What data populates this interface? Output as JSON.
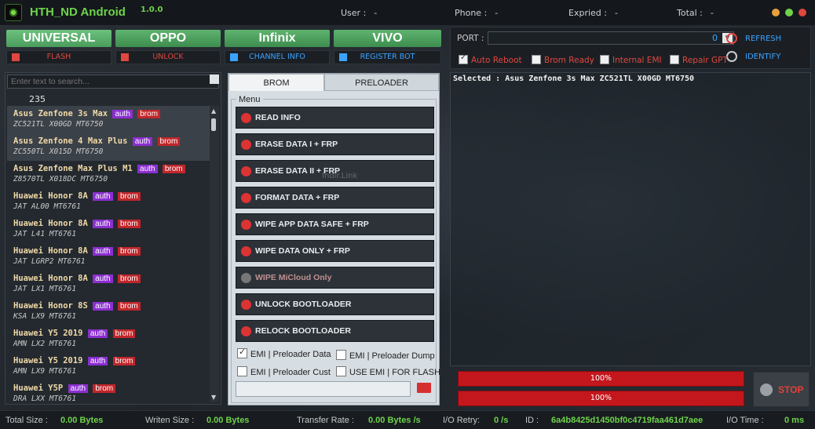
{
  "app": {
    "title": "HTH_ND Android",
    "version": "1.0.0"
  },
  "header": {
    "user_label": "User :",
    "user_value": "-",
    "phone_label": "Phone :",
    "phone_value": "-",
    "expired_label": "Expried :",
    "expired_value": "-",
    "total_label": "Total :",
    "total_value": "-"
  },
  "window_controls": {
    "colors": [
      "#e8a13a",
      "#6fd34a",
      "#e0473f"
    ]
  },
  "brands": [
    "UNIVERSAL",
    "OPPO",
    "Infinix",
    "VIVO"
  ],
  "subbuttons": [
    {
      "label": "FLASH",
      "icon": "flash-icon",
      "color": "#e0473f"
    },
    {
      "label": "UNLOCK",
      "icon": "unlock-icon",
      "color": "#e0473f"
    },
    {
      "label": "CHANNEL INFO",
      "icon": "channel-info-icon",
      "color": "#3ba3ff"
    },
    {
      "label": "REGISTER BOT",
      "icon": "register-bot-icon",
      "color": "#3ba3ff"
    }
  ],
  "model_list": {
    "search_placeholder": "Enter text to search...",
    "count": "235",
    "items": [
      {
        "name": "Asus Zenfone 3s Max",
        "code": "ZC521TL X00GD MT6750",
        "badge1": "auth",
        "badge2": "brom"
      },
      {
        "name": "Asus Zenfone 4 Max Plus",
        "code": "ZC550TL X015D MT6750",
        "badge1": "auth",
        "badge2": "brom"
      },
      {
        "name": "Asus Zenfone Max Plus M1",
        "code": "Z8570TL X018DC MT6750",
        "badge1": "auth",
        "badge2": "brom"
      },
      {
        "name": "Huawei Honor 8A",
        "code": "JAT AL00 MT6761",
        "badge1": "auth",
        "badge2": "brom"
      },
      {
        "name": "Huawei Honor 8A",
        "code": "JAT L41 MT6761",
        "badge1": "auth",
        "badge2": "brom"
      },
      {
        "name": "Huawei Honor 8A",
        "code": "JAT LGRP2 MT6761",
        "badge1": "auth",
        "badge2": "brom"
      },
      {
        "name": "Huawei Honor 8A",
        "code": "JAT LX1 MT6761",
        "badge1": "auth",
        "badge2": "brom"
      },
      {
        "name": "Huawei Honor 8S",
        "code": "KSA LX9 MT6761",
        "badge1": "auth",
        "badge2": "brom"
      },
      {
        "name": "Huawei Y5 2019",
        "code": "AMN LX2 MT6761",
        "badge1": "auth",
        "badge2": "brom"
      },
      {
        "name": "Huawei Y5 2019",
        "code": "AMN LX9 MT6761",
        "badge1": "auth",
        "badge2": "brom"
      },
      {
        "name": "Huawei Y5P",
        "code": "DRA LXX MT6761",
        "badge1": "auth",
        "badge2": "brom"
      }
    ]
  },
  "center": {
    "tabs": [
      "BROM",
      "PRELOADER"
    ],
    "menu_label": "Menu",
    "actions": [
      {
        "label": "READ INFO",
        "icon": "read-info-icon"
      },
      {
        "label": "ERASE DATA I + FRP",
        "icon": "erase-icon"
      },
      {
        "label": "ERASE DATA II + FRP",
        "icon": "erase-icon"
      },
      {
        "label": "FORMAT DATA + FRP",
        "icon": "format-icon"
      },
      {
        "label": "WIPE APP DATA SAFE + FRP",
        "icon": "wipe-icon"
      },
      {
        "label": "WIPE DATA ONLY + FRP",
        "icon": "wipe-icon"
      },
      {
        "label": "WIPE MiCloud Only",
        "icon": "micloud-icon"
      },
      {
        "label": "UNLOCK BOOTLOADER",
        "icon": "unlock-bootloader-icon"
      },
      {
        "label": "RELOCK BOOTLOADER",
        "icon": "relock-bootloader-icon"
      }
    ],
    "checkboxes": [
      {
        "label": "EMI | Preloader Data",
        "checked": true
      },
      {
        "label": "EMI | Preloader Dump",
        "checked": false
      },
      {
        "label": "EMI | Preloader Cust",
        "checked": false
      },
      {
        "label": "USE EMI | FOR FLASH",
        "checked": false
      }
    ],
    "path_value": ""
  },
  "port": {
    "label": "PORT :",
    "value": "0",
    "refresh_label": "REFRESH",
    "identify_label": "IDENTIFY"
  },
  "options": [
    {
      "label": "Auto Reboot",
      "checked": true
    },
    {
      "label": "Brom Ready",
      "checked": false
    },
    {
      "label": "Internal EMI",
      "checked": false
    },
    {
      "label": "Repair GPT",
      "checked": false
    }
  ],
  "log": {
    "text": "Selected : Asus Zenfone 3s Max ZC521TL X00GD MT6750",
    "watermark": "Indir.Link"
  },
  "progress": [
    {
      "value": 100,
      "label": "100%"
    },
    {
      "value": 100,
      "label": "100%"
    }
  ],
  "stop_label": "STOP",
  "statusbar": {
    "total_size_label": "Total Size :",
    "total_size_value": "0.00 Bytes",
    "written_label": "Writen Size :",
    "written_value": "0.00 Bytes",
    "rate_label": "Transfer Rate :",
    "rate_value": "0.00 Bytes /s",
    "retry_label": "I/O Retry:",
    "retry_value": "0 /s",
    "id_label": "ID :",
    "id_value": "6a4b8425d1450bf0c4719faa461d7aee",
    "io_time_label": "I/O Time :",
    "io_time_value": "0 ms"
  }
}
